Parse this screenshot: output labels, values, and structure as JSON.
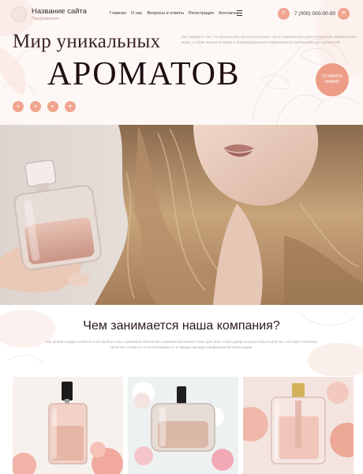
{
  "header": {
    "site_name": "Название сайта",
    "site_subtitle": "Парфюмерия",
    "nav": [
      "Главная",
      "О нас",
      "Вопросы и ответы",
      "Регистрация",
      "Контакты"
    ],
    "phone": "7 (000) 000-00-00"
  },
  "hero": {
    "title_line1": "Мир уникальных",
    "title_line2": "АРОМАТОВ",
    "text": "Мы гордимся тем, что предлагаем как классические, так и современные духи от ведущих парфюмеров мира, а также нишевые марки и инидивидуальные парфюмерные композиции для ценителей.",
    "button_label": "ОСТАВИТЬ ЗАЯВКУ"
  },
  "socials": [
    "vk-icon",
    "odnoklassniki-icon",
    "youtube-icon",
    "telegram-icon"
  ],
  "about": {
    "title": "Чем занимается наша компания?",
    "text": "Мы ценим каждого клиента и его выбор и мы стремимся обеспечить уникальный шопинг-опыт для всех. Наша дверь всегда открыта для тех, кто ищет отличное качество стоимость и неповторимость в каждом аккорде парфюмерной композиции."
  },
  "colors": {
    "accent": "#f0a58f",
    "title": "#1f0e12",
    "muted": "#b8a8a6"
  }
}
